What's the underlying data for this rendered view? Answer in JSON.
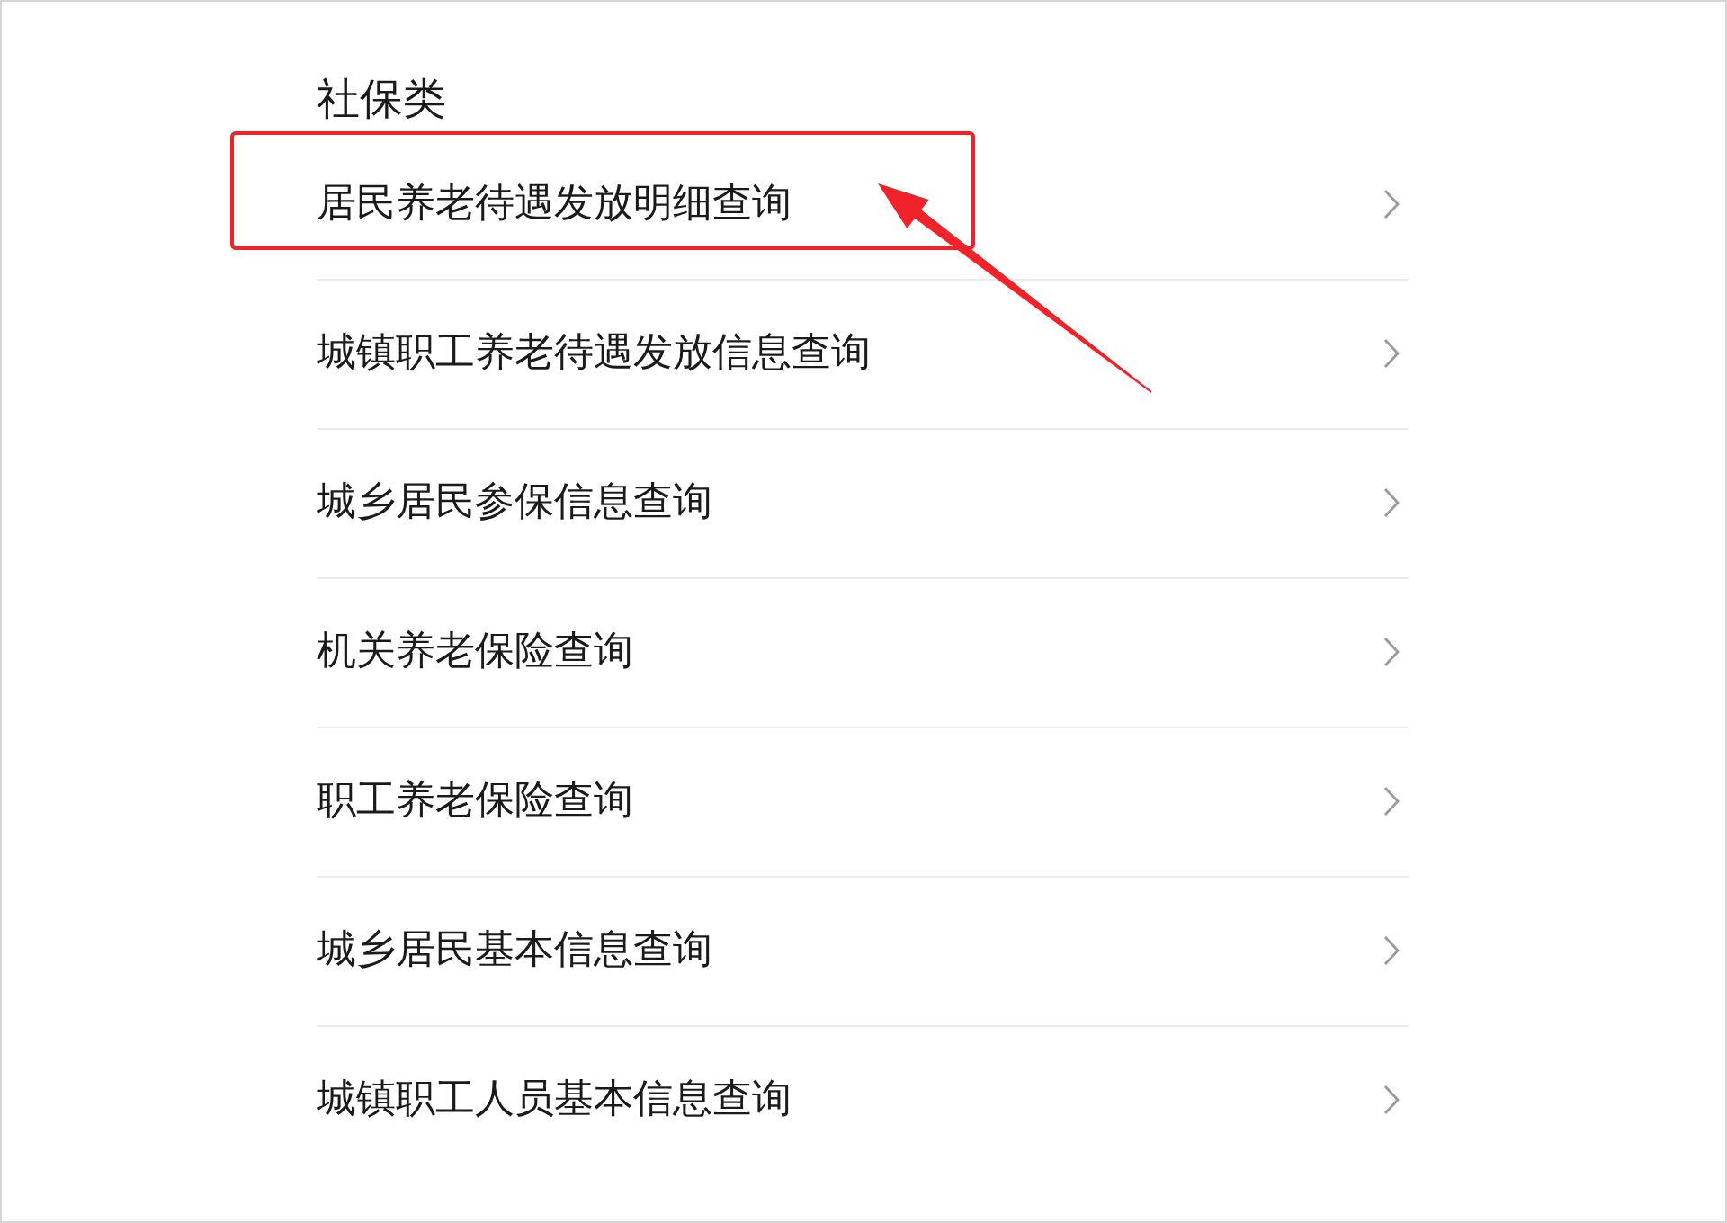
{
  "section": {
    "title": "社保类",
    "items": [
      {
        "label": "居民养老待遇发放明细查询",
        "highlighted": true
      },
      {
        "label": "城镇职工养老待遇发放信息查询",
        "highlighted": false
      },
      {
        "label": "城乡居民参保信息查询",
        "highlighted": false
      },
      {
        "label": "机关养老保险查询",
        "highlighted": false
      },
      {
        "label": "职工养老保险查询",
        "highlighted": false
      },
      {
        "label": "城乡居民基本信息查询",
        "highlighted": false
      },
      {
        "label": "城镇职工人员基本信息查询",
        "highlighted": false
      }
    ]
  }
}
